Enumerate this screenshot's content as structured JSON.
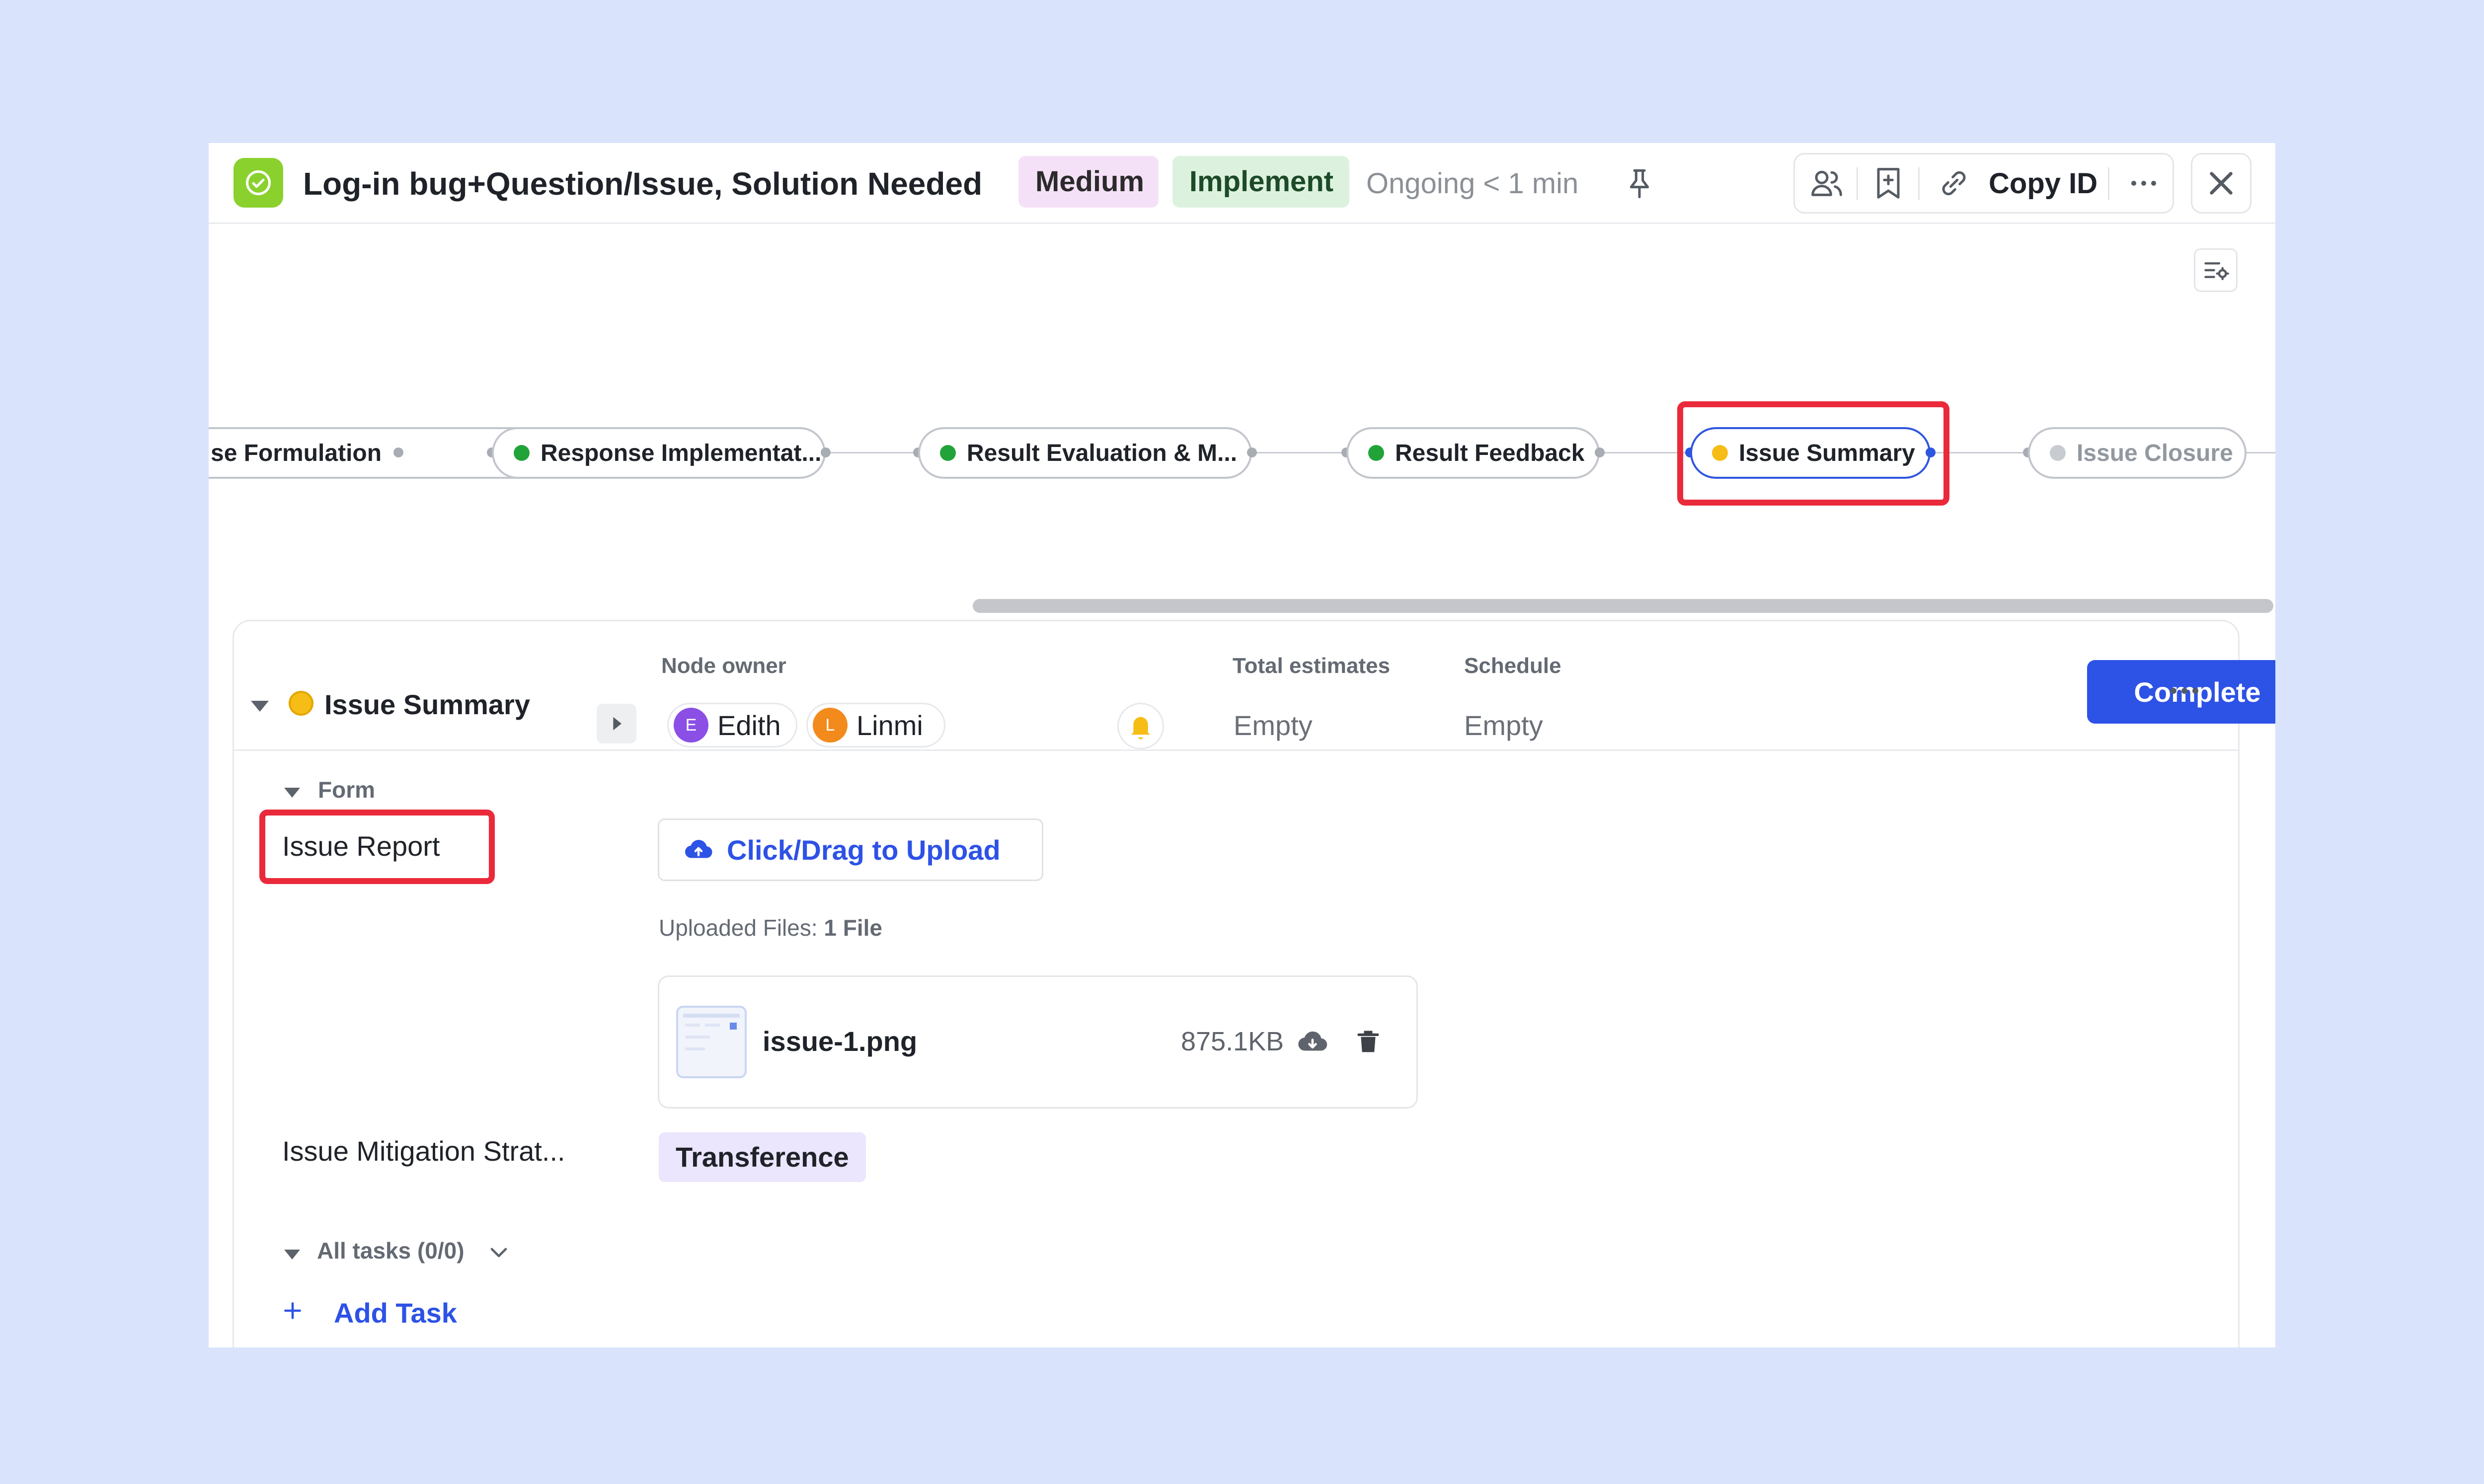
{
  "header": {
    "title": "Log-in bug+Question/Issue, Solution Needed",
    "priority_badge": "Medium",
    "stage_badge": "Implement",
    "status_text": "Ongoing < 1 min",
    "copy_id_label": "Copy ID"
  },
  "flow": {
    "nodes": [
      {
        "label": "se Formulation",
        "status": "none"
      },
      {
        "label": "Response Implementat...",
        "status": "completed"
      },
      {
        "label": "Result Evaluation & M...",
        "status": "completed"
      },
      {
        "label": "Result Feedback",
        "status": "completed"
      },
      {
        "label": "Issue Summary",
        "status": "in-progress"
      },
      {
        "label": "Issue Closure",
        "status": "not-started"
      }
    ]
  },
  "panel": {
    "node_title": "Issue Summary",
    "node_owner_label": "Node owner",
    "owners": [
      {
        "initial": "E",
        "name": "Edith",
        "color": "#8b4fe6"
      },
      {
        "initial": "L",
        "name": "Linmi",
        "color": "#f28a1c"
      }
    ],
    "total_estimates_label": "Total estimates",
    "total_estimates_value": "Empty",
    "schedule_label": "Schedule",
    "schedule_value": "Empty",
    "complete_label": "Complete"
  },
  "form": {
    "section_label": "Form",
    "issue_report_label": "Issue Report",
    "upload_label": "Click/Drag to Upload",
    "uploaded_prefix": "Uploaded Files: ",
    "uploaded_count": "1 File",
    "file": {
      "name": "issue-1.png",
      "size": "875.1KB"
    },
    "mitigation_label": "Issue Mitigation Strat...",
    "mitigation_value": "Transference"
  },
  "tasks": {
    "all_tasks_label": "All tasks (0/0)",
    "add_task_label": "Add Task"
  },
  "colors": {
    "accent": "#2d52e6",
    "completed": "#22a33a",
    "in_progress": "#f6bd16",
    "not_started": "#c8cbd0",
    "highlight": "#ea2a3b"
  }
}
